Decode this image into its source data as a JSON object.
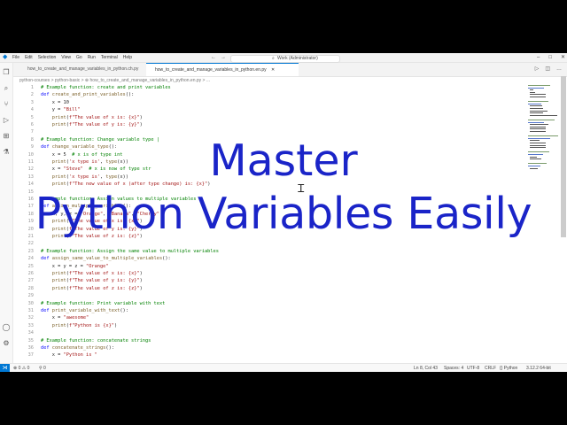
{
  "window": {
    "title": "Work (Administrator)",
    "menu": [
      "File",
      "Edit",
      "Selection",
      "View",
      "Go",
      "Run",
      "Terminal",
      "Help"
    ]
  },
  "tabs": [
    {
      "label": "how_to_create_and_manage_variables_in_python.ch.py",
      "active": false
    },
    {
      "label": "how_to_create_and_manage_variables_in_python.en.py",
      "active": true
    }
  ],
  "breadcrumb": "python-courses > python-basic > ⊕ how_to_create_and_manage_variables_in_python.en.py > ...",
  "code_lines": [
    {
      "n": "1",
      "t": "# Example function: create and print variables"
    },
    {
      "n": "2",
      "t": "def create_and_print_variables():"
    },
    {
      "n": "3",
      "t": "    x = 10"
    },
    {
      "n": "4",
      "t": "    y = \"Bill\""
    },
    {
      "n": "5",
      "t": "    print(f\"The value of x is: {x}\")"
    },
    {
      "n": "6",
      "t": "    print(f\"The value of y is: {y}\")"
    },
    {
      "n": "7",
      "t": ""
    },
    {
      "n": "8",
      "t": "# Example function: Change variable type |"
    },
    {
      "n": "9",
      "t": "def change_variable_type():"
    },
    {
      "n": "10",
      "t": "    x = 5  # x is of type int"
    },
    {
      "n": "11",
      "t": "    print('x type is', type(x))"
    },
    {
      "n": "12",
      "t": "    x = \"Steve\"  # x is now of type str"
    },
    {
      "n": "13",
      "t": "    print('x type is', type(x))"
    },
    {
      "n": "14",
      "t": "    print(f\"The new value of x (after type change) is: {x}\")"
    },
    {
      "n": "15",
      "t": ""
    },
    {
      "n": "16",
      "t": "# Example function: Assign values to multiple variables"
    },
    {
      "n": "17",
      "t": "def assign_multiple_variables():"
    },
    {
      "n": "18",
      "t": "    x, y, z = \"Orange\", \"Banana\", \"Cherry\""
    },
    {
      "n": "19",
      "t": "    print(f\"The value of x is: {x}\")"
    },
    {
      "n": "20",
      "t": "    print(f\"The value of y is: {y}\")"
    },
    {
      "n": "21",
      "t": "    print(f\"The value of z is: {z}\")"
    },
    {
      "n": "22",
      "t": ""
    },
    {
      "n": "23",
      "t": "# Example function: Assign the same value to multiple variables"
    },
    {
      "n": "24",
      "t": "def assign_same_value_to_multiple_variables():"
    },
    {
      "n": "25",
      "t": "    x = y = z = \"Orange\""
    },
    {
      "n": "26",
      "t": "    print(f\"The value of x is: {x}\")"
    },
    {
      "n": "27",
      "t": "    print(f\"The value of y is: {y}\")"
    },
    {
      "n": "28",
      "t": "    print(f\"The value of z is: {z}\")"
    },
    {
      "n": "29",
      "t": ""
    },
    {
      "n": "30",
      "t": "# Example function: Print variable with text"
    },
    {
      "n": "31",
      "t": "def print_variable_with_text():"
    },
    {
      "n": "32",
      "t": "    x = \"awesome\""
    },
    {
      "n": "33",
      "t": "    print(f\"Python is {x}\")"
    },
    {
      "n": "34",
      "t": ""
    },
    {
      "n": "35",
      "t": "# Example function: concatenate strings"
    },
    {
      "n": "36",
      "t": "def concatenate_strings():"
    },
    {
      "n": "37",
      "t": "    x = \"Python is \""
    }
  ],
  "overlay": {
    "line1": "Master",
    "line2": "Python Variables Easily",
    "color": "#1a24c8"
  },
  "statusbar": {
    "problems": "⊗ 0 ⚠ 0",
    "ports": "⚲ 0",
    "cursor_pos": "Ln 8, Col 43",
    "spaces": "Spaces: 4",
    "encoding": "UTF-8",
    "eol": "CRLF",
    "language": "{} Python",
    "interpreter": "3.12.2 64-bit"
  },
  "colors": {
    "accent": "#0078d4",
    "comment": "#008000",
    "keyword": "#0000ff",
    "string": "#a31515",
    "function": "#795e26"
  },
  "icons": [
    "vscode-logo-icon",
    "explorer-icon",
    "search-icon",
    "source-control-icon",
    "run-debug-icon",
    "extensions-icon",
    "testing-icon",
    "account-icon",
    "settings-icon"
  ]
}
